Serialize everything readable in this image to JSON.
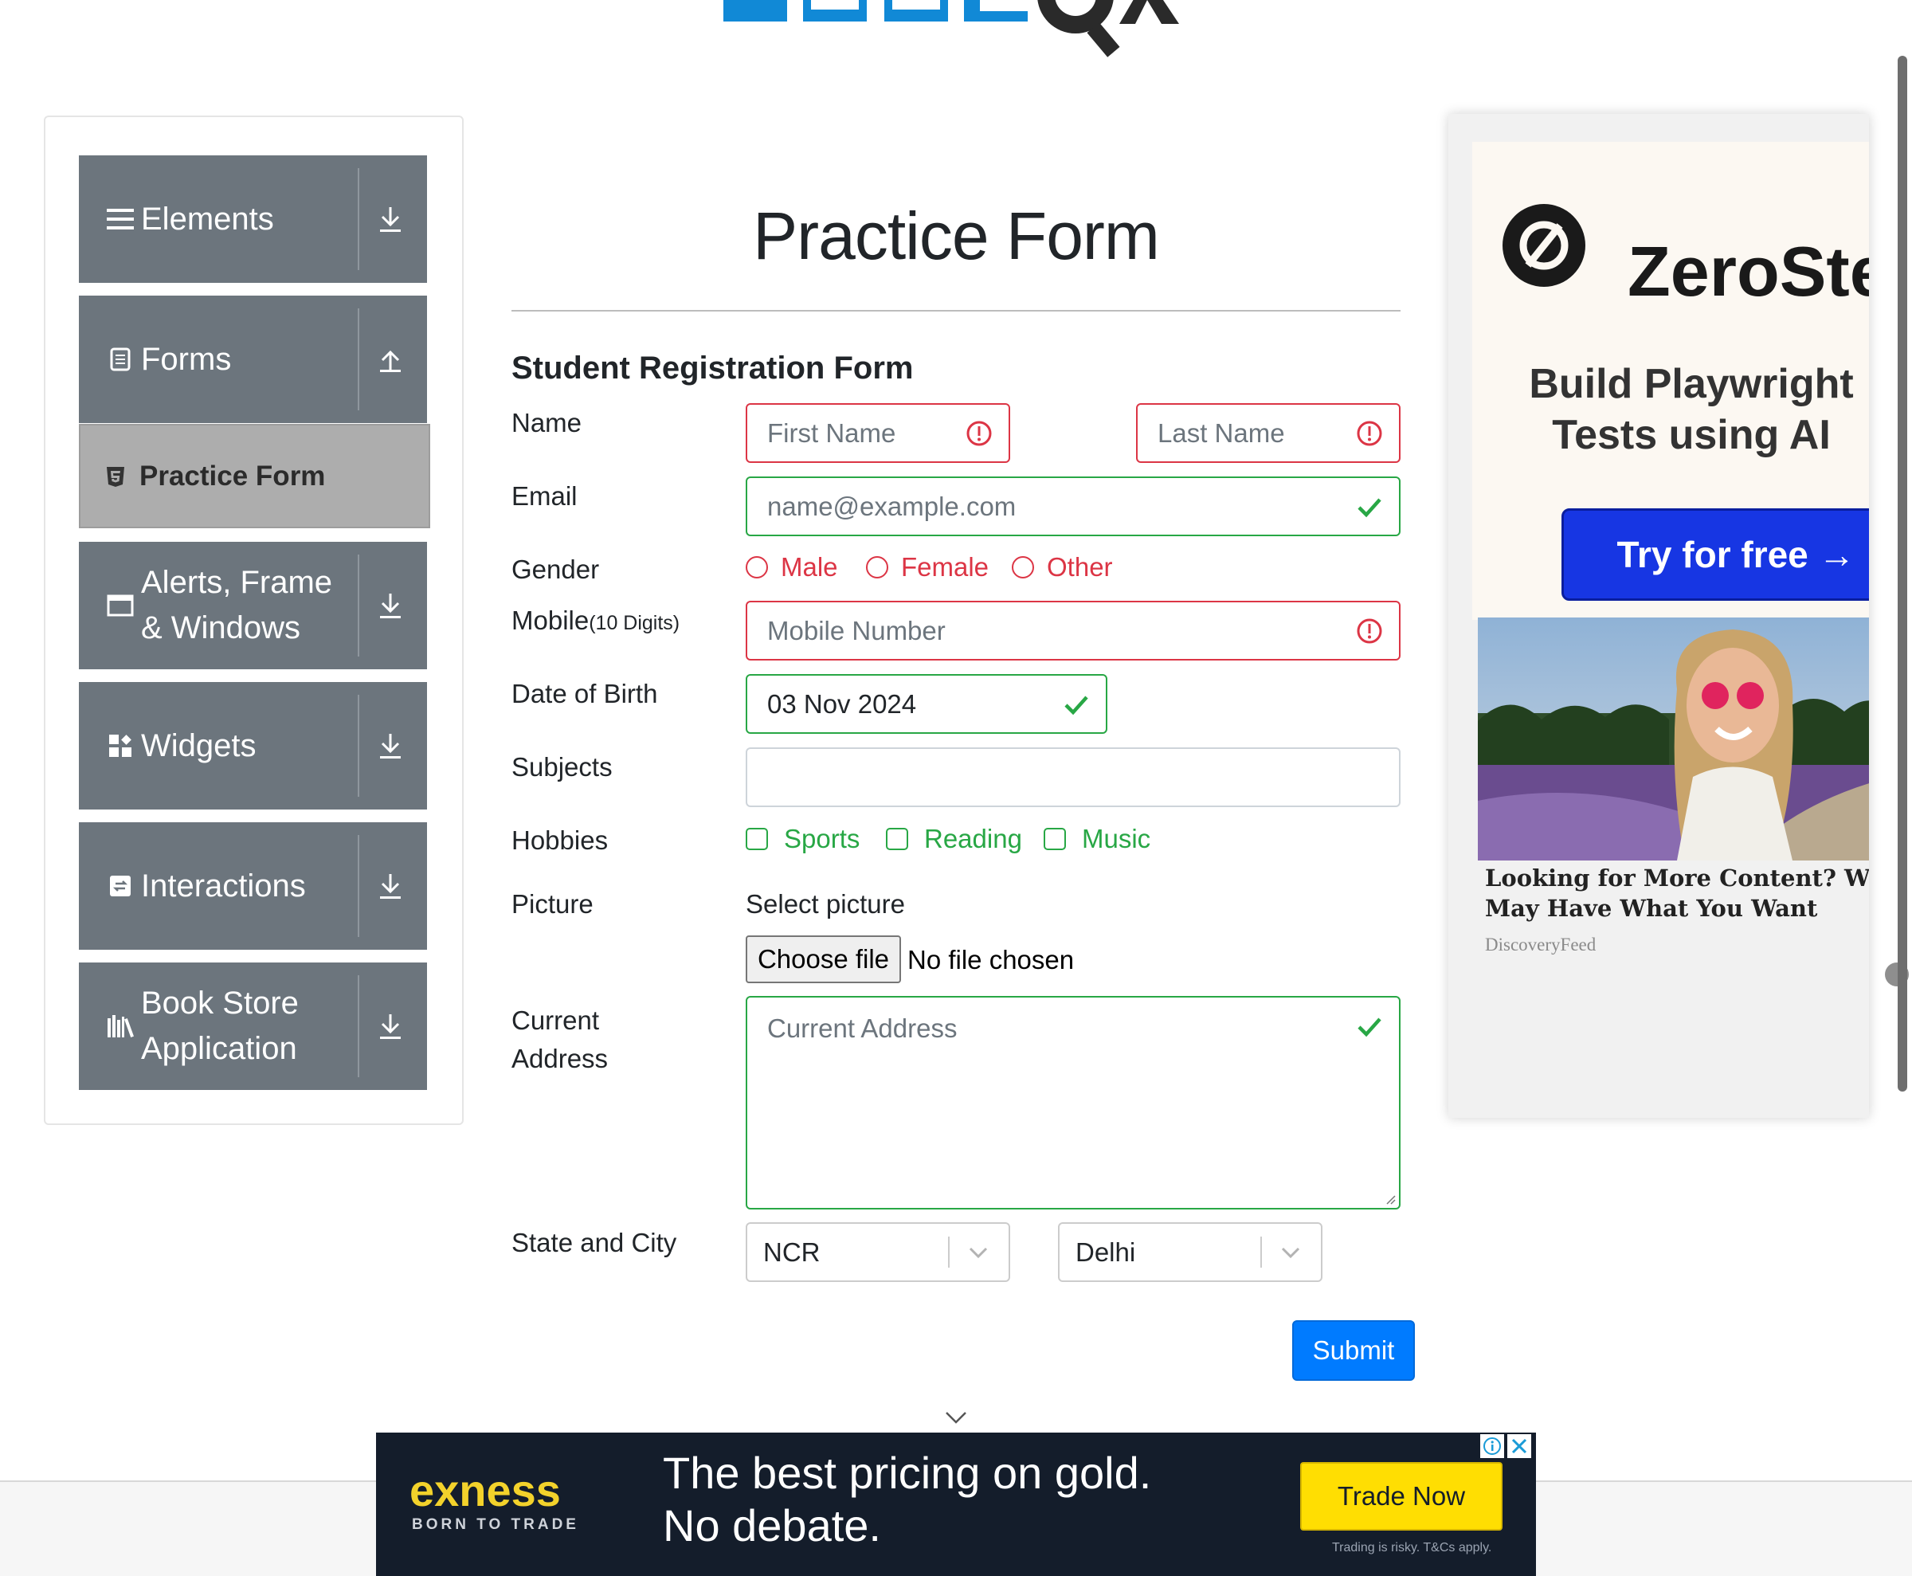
{
  "logo": {
    "alt": "ToolsQA"
  },
  "sidebar": {
    "groups": [
      {
        "label": "Elements",
        "icon": "hamburger-icon",
        "arrow": "download-arrow-icon"
      },
      {
        "label": "Forms",
        "icon": "document-icon",
        "arrow": "upload-arrow-icon"
      },
      {
        "label": "Alerts, Frame & Windows",
        "icon": "window-icon",
        "arrow": "download-arrow-icon"
      },
      {
        "label": "Widgets",
        "icon": "widgets-icon",
        "arrow": "download-arrow-icon"
      },
      {
        "label": "Interactions",
        "icon": "interactions-icon",
        "arrow": "download-arrow-icon"
      },
      {
        "label": "Book Store Application",
        "icon": "books-icon",
        "arrow": "download-arrow-icon"
      }
    ],
    "active_item": {
      "label": "Practice Form",
      "icon": "html5-icon"
    }
  },
  "form": {
    "title": "Practice Form",
    "subtitle": "Student Registration Form",
    "labels": {
      "name": "Name",
      "email": "Email",
      "gender": "Gender",
      "mobile": "Mobile",
      "mobile_hint": "(10 Digits)",
      "dob": "Date of Birth",
      "subjects": "Subjects",
      "hobbies": "Hobbies",
      "picture": "Picture",
      "address_line1": "Current",
      "address_line2": "Address",
      "state_city": "State and City"
    },
    "first_name_placeholder": "First Name",
    "last_name_placeholder": "Last Name",
    "email_placeholder": "name@example.com",
    "gender_options": [
      "Male",
      "Female",
      "Other"
    ],
    "mobile_placeholder": "Mobile Number",
    "dob_value": "03 Nov 2024",
    "subjects_value": "",
    "hobby_options": [
      "Sports",
      "Reading",
      "Music"
    ],
    "picture_prompt": "Select picture",
    "file_button": "Choose file",
    "file_status": "No file chosen",
    "address_placeholder": "Current Address",
    "state_value": "NCR",
    "city_value": "Delhi",
    "submit_label": "Submit",
    "colors": {
      "invalid": "#dc3545",
      "valid": "#28a745",
      "primary": "#007bff"
    }
  },
  "right_ad": {
    "brand": "ZeroStep",
    "tagline": "Build Playwright Tests using AI",
    "cta": "Try for free →",
    "caption": "Looking for More Content? We May Have What You Want",
    "source": "DiscoveryFeed"
  },
  "bottom_ad": {
    "brand": "exness",
    "brand_tagline": "BORN TO TRADE",
    "headline_line1": "The best pricing on gold.",
    "headline_line2": "No debate.",
    "cta": "Trade Now",
    "disclaimer": "Trading is risky. T&Cs apply.",
    "brand_color": "#f3d22b",
    "cta_color": "#ffde02"
  }
}
